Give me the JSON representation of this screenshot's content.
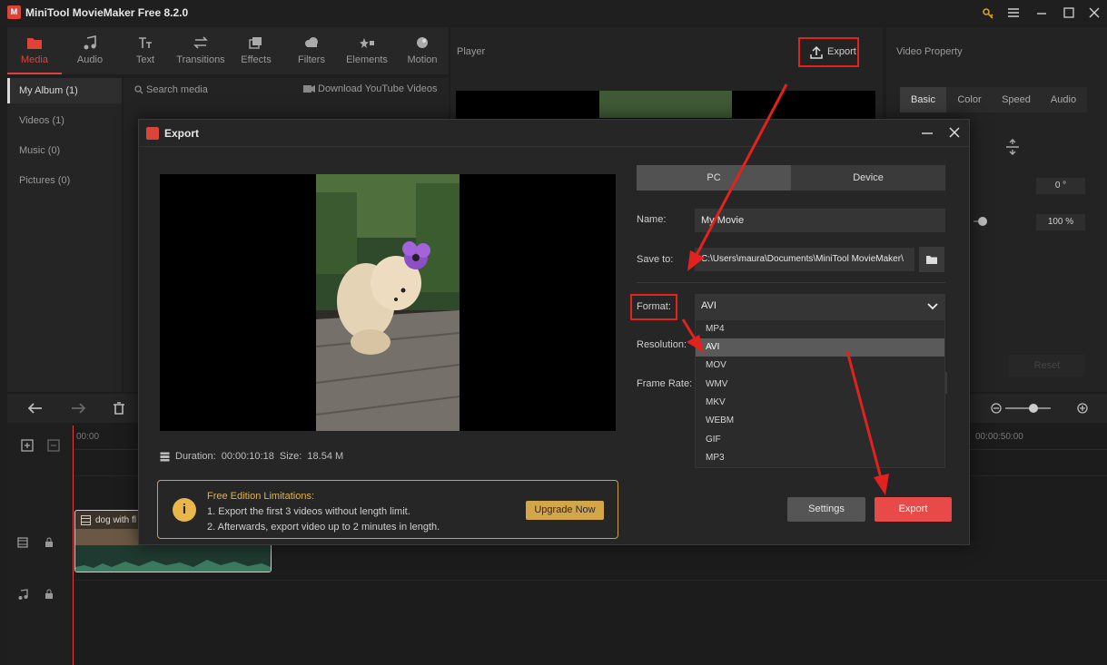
{
  "app": {
    "title": "MiniTool MovieMaker Free 8.2.0",
    "logo_text": "M"
  },
  "toolbar": {
    "tabs": [
      {
        "label": "Media",
        "icon": "folder-icon"
      },
      {
        "label": "Audio",
        "icon": "music-note-icon"
      },
      {
        "label": "Text",
        "icon": "text-icon"
      },
      {
        "label": "Transitions",
        "icon": "swap-arrows-icon"
      },
      {
        "label": "Effects",
        "icon": "layers-icon"
      },
      {
        "label": "Filters",
        "icon": "cloud-icon"
      },
      {
        "label": "Elements",
        "icon": "stars-icon"
      },
      {
        "label": "Motion",
        "icon": "ball-icon"
      }
    ],
    "active": "Media"
  },
  "media": {
    "albums": [
      "My Album (1)",
      "Videos (1)",
      "Music (0)",
      "Pictures (0)"
    ],
    "search_placeholder": "Search media",
    "download_label": "Download YouTube Videos"
  },
  "player": {
    "label": "Player",
    "export_label": "Export"
  },
  "properties": {
    "label": "Video Property",
    "tabs": [
      "Basic",
      "Color",
      "Speed",
      "Audio"
    ],
    "active_tab": "Basic",
    "rotation_value": "0 °",
    "scale_value": "100 %",
    "reset_label": "Reset"
  },
  "timeline": {
    "ruler_start": "00:00",
    "ruler_end": "00:00:50:00",
    "clip_name": "dog with fl"
  },
  "dialog": {
    "title": "Export",
    "duration_label": "Duration:",
    "duration_value": "00:00:10:18",
    "size_label": "Size:",
    "size_value": "18.54 M",
    "targets": [
      "PC",
      "Device"
    ],
    "active_target": "PC",
    "name_label": "Name:",
    "name_value": "My Movie",
    "save_label": "Save to:",
    "save_value": "C:\\Users\\maura\\Documents\\MiniTool MovieMaker\\",
    "format_label": "Format:",
    "format_value": "AVI",
    "resolution_label": "Resolution:",
    "framerate_label": "Frame Rate:",
    "format_options": [
      "MP4",
      "AVI",
      "MOV",
      "WMV",
      "MKV",
      "WEBM",
      "GIF",
      "MP3"
    ],
    "selected_option": "AVI",
    "limits": {
      "title": "Free Edition Limitations:",
      "line1": "1. Export the first 3 videos without length limit.",
      "line2": "2. Afterwards, export video up to 2 minutes in length.",
      "upgrade_label": "Upgrade Now"
    },
    "settings_label": "Settings",
    "export_label": "Export"
  },
  "colors": {
    "accent": "#e0423a",
    "annotation": "#e3221d",
    "upgrade": "#d3a64a",
    "export": "#e84a4a"
  }
}
